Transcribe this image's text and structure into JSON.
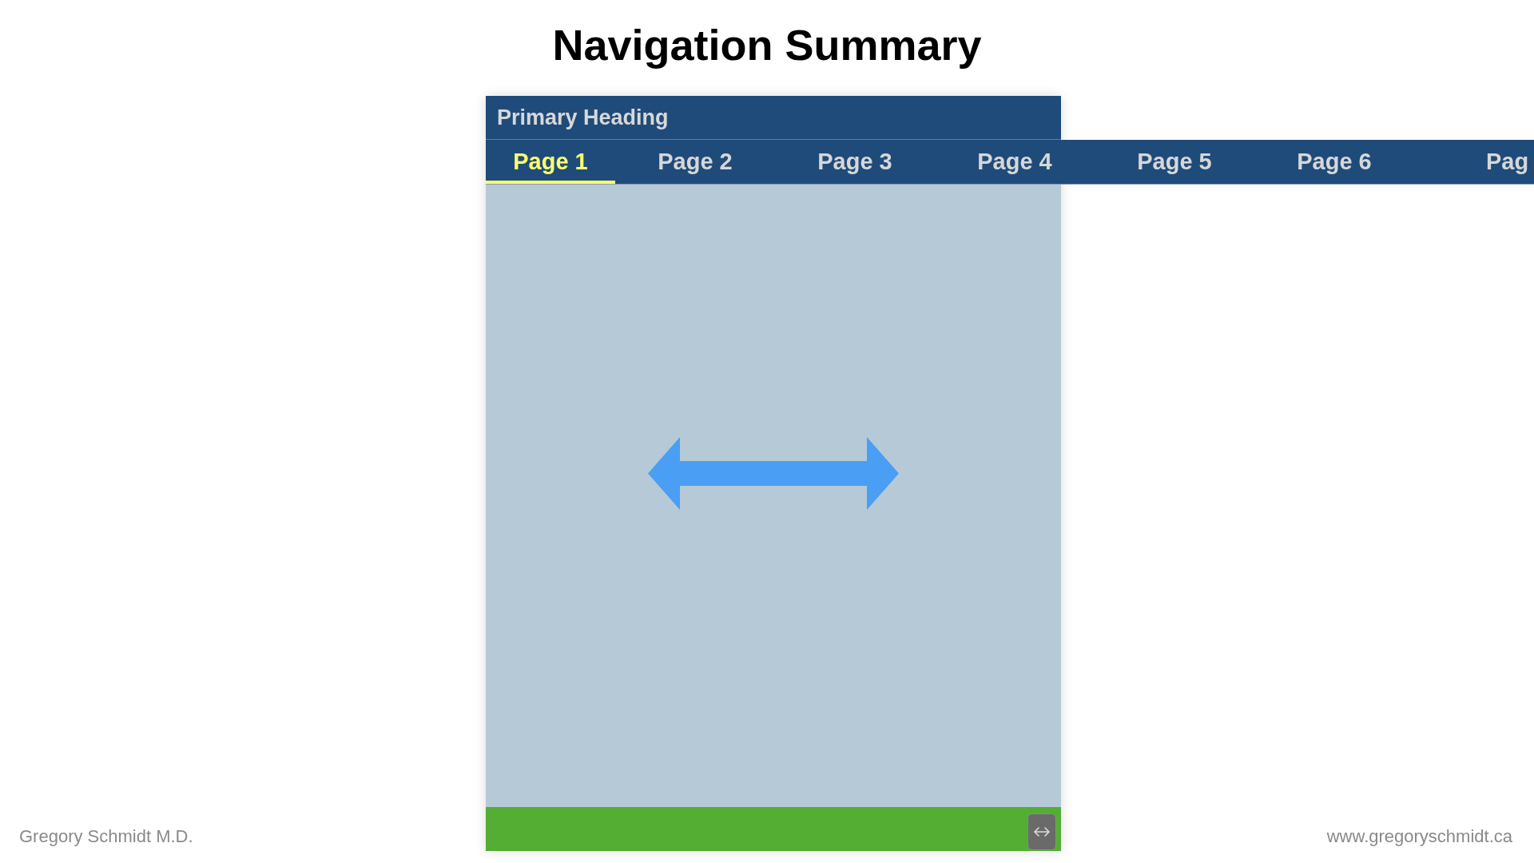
{
  "title": "Navigation Summary",
  "app": {
    "heading": "Primary Heading",
    "tabs": [
      {
        "label": "Page 1",
        "selected": true
      },
      {
        "label": "Page 2",
        "selected": false
      },
      {
        "label": "Page 3",
        "selected": false
      },
      {
        "label": "Page 4",
        "selected": false
      },
      {
        "label": "Page 5",
        "selected": false
      },
      {
        "label": "Page 6",
        "selected": false
      },
      {
        "label": "Pag",
        "selected": false
      }
    ]
  },
  "footer": {
    "author": "Gregory Schmidt M.D.",
    "website": "www.gregoryschmidt.ca"
  }
}
